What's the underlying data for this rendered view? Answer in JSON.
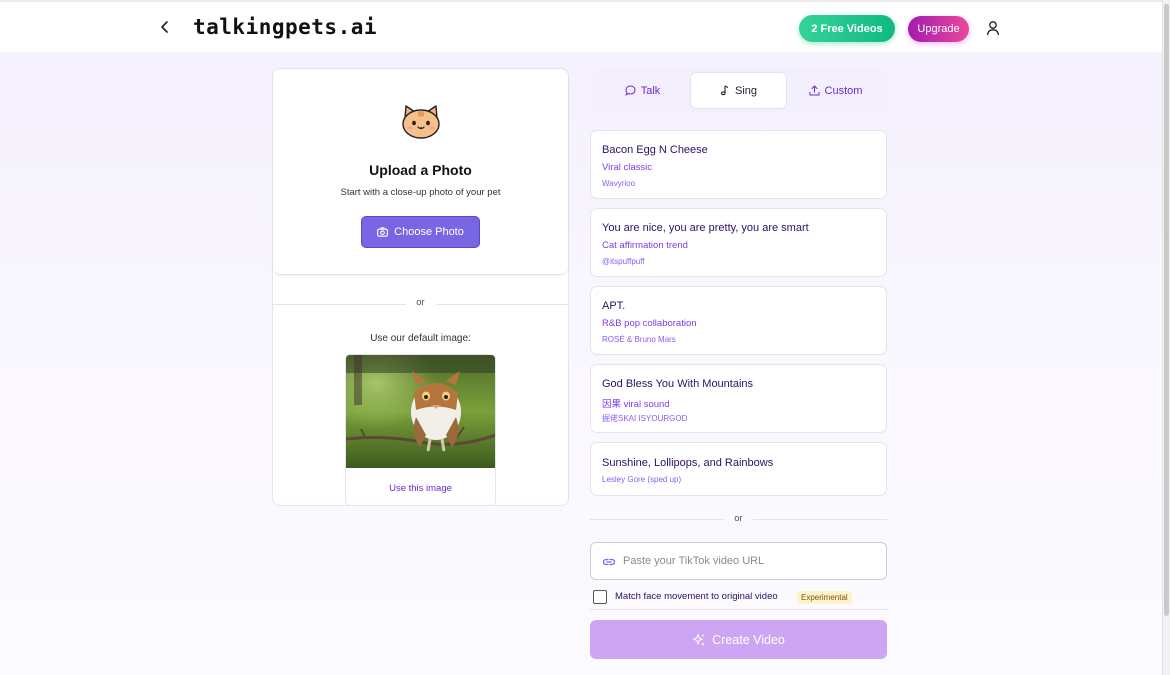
{
  "header": {
    "logo": "talkingpets.ai",
    "free_videos_label": "2 Free Videos",
    "upgrade_label": "Upgrade",
    "colors": {
      "free": "#10b981",
      "upgrade_start": "#a21caf",
      "upgrade_end": "#ec4899"
    }
  },
  "upload": {
    "title": "Upload a Photo",
    "subtitle": "Start with a close-up photo of your pet",
    "choose_label": "Choose Photo",
    "or_label": "or",
    "default_label": "Use our default image:",
    "use_image_label": "Use this image"
  },
  "tabs": [
    {
      "label": "Talk",
      "icon": "chat-bubble-icon",
      "active": false
    },
    {
      "label": "Sing",
      "icon": "music-note-icon",
      "active": true
    },
    {
      "label": "Custom",
      "icon": "upload-icon",
      "active": false
    }
  ],
  "songs": [
    {
      "title": "Bacon Egg N Cheese",
      "subtitle": "Viral classic",
      "artist": "Wavyrioo"
    },
    {
      "title": "You are nice, you are pretty, you are smart",
      "subtitle": "Cat affirmation trend",
      "artist": "@itspuffpuff"
    },
    {
      "title": "APT.",
      "subtitle": "R&B pop collaboration",
      "artist": "ROSÉ & Bruno Mars"
    },
    {
      "title": "God Bless You With Mountains",
      "subtitle": "因果 viral sound",
      "artist": "掘佬SKAI ISYOURGOD"
    },
    {
      "title": "Sunshine, Lollipops, and Rainbows",
      "subtitle": "",
      "artist": "Lesley Gore (sped up)"
    }
  ],
  "tiktok": {
    "or_label": "or",
    "placeholder": "Paste your TikTok video URL",
    "match_label": "Match face movement to original video",
    "badge": "Experimental",
    "create_label": "Create Video"
  },
  "accent": "#7866e3"
}
